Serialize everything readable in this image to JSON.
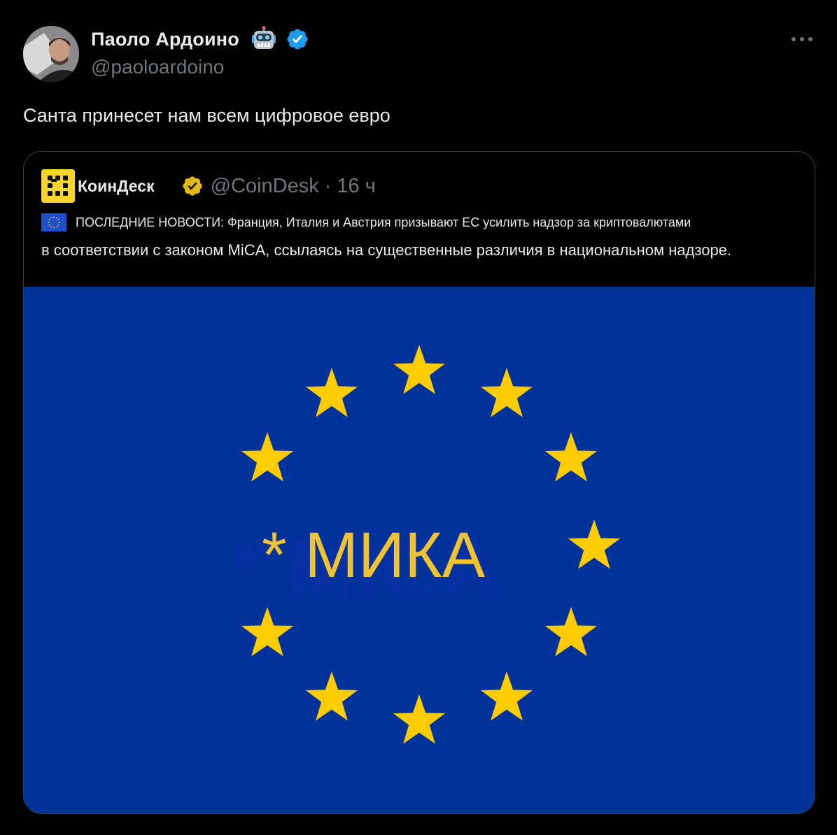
{
  "author": {
    "name": "Паоло Ардоино",
    "handle": "@paoloardoino",
    "name_emoji": "robot-face-emoji",
    "verified": true,
    "badge_color": "#1d9bf0"
  },
  "tweet": {
    "text": "Санта принесет нам всем цифровое евро"
  },
  "quoted_tweet": {
    "author_name": "КоинДеск",
    "author_handle": "@CoinDesk",
    "separator": "·",
    "time": "16 ч",
    "badge": "gold-verified-badge",
    "badge_color": "#e2b719",
    "line1": "ПОСЛЕДНИЕ НОВОСТИ: Франция, Италия и Австрия призывают ЕС усилить надзор за криптовалютами",
    "line2": "в соответствии с законом MiCA, ссылаясь на существенные различия в национальном надзоре.",
    "image": {
      "caption_text": "* МИКА",
      "background_color": "#003399",
      "star_color": "#ffcc00",
      "text_color": "#f1c232",
      "star_count": 12
    }
  }
}
